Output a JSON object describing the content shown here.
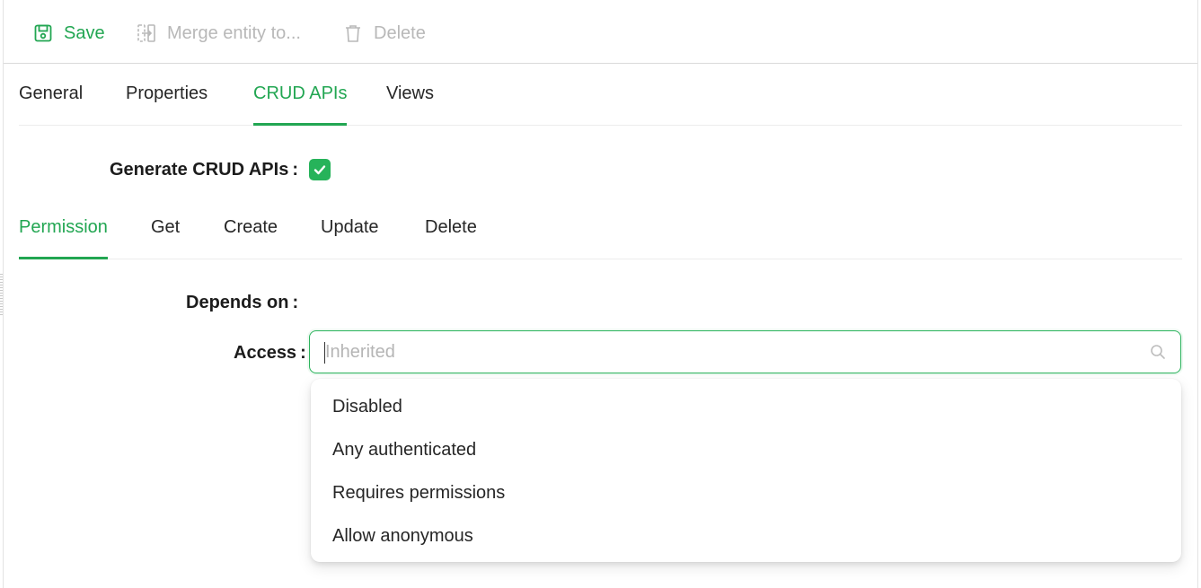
{
  "toolbar": {
    "save_label": "Save",
    "merge_label": "Merge entity to...",
    "delete_label": "Delete"
  },
  "main_tabs": [
    {
      "label": "General",
      "active": false
    },
    {
      "label": "Properties",
      "active": false
    },
    {
      "label": "CRUD APIs",
      "active": true
    },
    {
      "label": "Views",
      "active": false
    }
  ],
  "form": {
    "generate_label": "Generate CRUD APIs",
    "generate_checked": true,
    "depends_label": "Depends on",
    "access_label": "Access",
    "access_placeholder": "Inherited"
  },
  "crud_tabs": [
    {
      "label": "Permission",
      "active": true
    },
    {
      "label": "Get",
      "active": false
    },
    {
      "label": "Create",
      "active": false
    },
    {
      "label": "Update",
      "active": false
    },
    {
      "label": "Delete",
      "active": false
    }
  ],
  "access_options": [
    "Disabled",
    "Any authenticated",
    "Requires permissions",
    "Allow anonymous"
  ],
  "colors": {
    "accent": "#22a652",
    "disabled": "#b8b8b8"
  }
}
